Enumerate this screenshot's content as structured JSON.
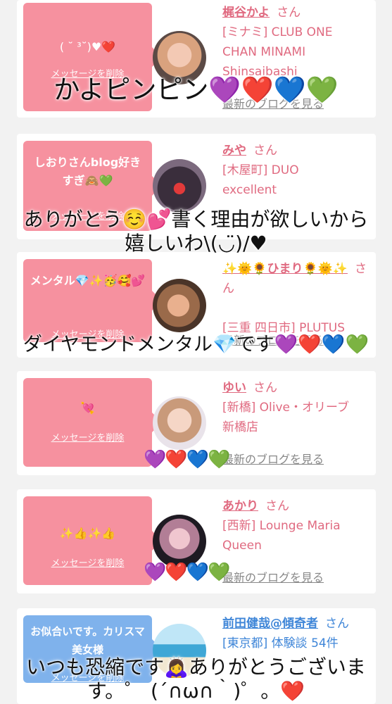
{
  "colors": {
    "pink": "#f6919f",
    "blue": "#7fb2ec",
    "name": "#e06a80",
    "name_blue": "#3f86d8"
  },
  "delete_label": "メッセージを削除",
  "blog_label": "最新のブログを見る",
  "san": "さん",
  "cards": [
    {
      "message": "( ˘ ³˘)♥❤️",
      "name": "梶谷かよ",
      "shop_lines": [
        "[ミナミ] CLUB ONE",
        "CHAN MINAMI",
        "Shinsaibashi"
      ]
    },
    {
      "message": "しおりさんblog好きすぎ🙈💚",
      "name": "みや",
      "shop_lines": [
        "[木屋町] DUO",
        "excellent"
      ]
    },
    {
      "message": "メンタル💎✨🥳🥰💕",
      "name": "✨🌞🌻ひまり🌻🌞✨",
      "shop_lines": [
        "[三重 四日市] PLUTUS"
      ]
    },
    {
      "message": "💘",
      "name": "ゆい",
      "shop_lines": [
        "[新橋] Olive・オリーブ",
        "新橋店"
      ]
    },
    {
      "message": "✨👍✨👍",
      "name": "あかり",
      "shop_lines": [
        "[西新] Lounge Maria",
        "Queen"
      ]
    },
    {
      "message": "お似合いです。カリスマ美女様",
      "name": "前田健哉@傾奇者",
      "shop_lines": [
        "[東京都] 体験談 54件"
      ]
    }
  ],
  "overlays": {
    "t1": "かよピンピン💜❤️💙💚",
    "t2a": "ありがとう☺️💕書く理由が欲しいから",
    "t2b": "嬉しいわ\\(◡̈)/♥︎",
    "t3": "ダイヤモンドメンタル💎です💜❤️💙💚",
    "h4": "💜❤️💙💚",
    "h5": "💜❤️💙💚",
    "t6a": "いつも恐縮です🙇‍♀️ありがとうございま",
    "t6b": "す。゜ (´∩ω∩｀)゜。❤️"
  }
}
